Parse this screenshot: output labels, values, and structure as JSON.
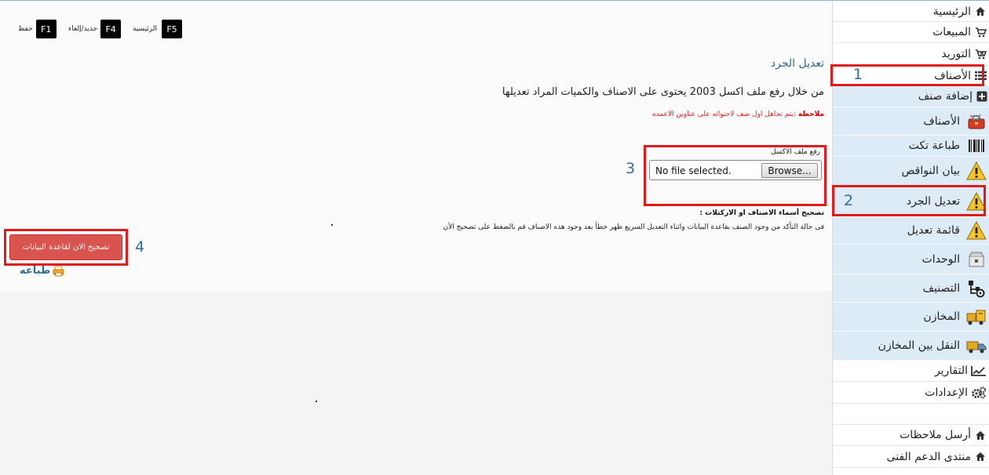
{
  "shortcuts": [
    {
      "key": "F1",
      "label": "حفظ"
    },
    {
      "key": "F4",
      "label": "جديد/إلغاء"
    },
    {
      "key": "F5",
      "label": "الرئيسية"
    }
  ],
  "main": {
    "title": "تعديل الجرد",
    "intro": "من خلال رفع ملف اكسل 2003 يحتوى على الاصناف والكميات المراد تعديلها",
    "note_label": "ملاحظة",
    "note_text": " :يتم تجاهل اول صف لاحتوائه على عناوين الاعمده",
    "upload_label": "رفع ملف الاكسل",
    "file_status": "No file selected.",
    "browse_label": "Browse...",
    "fix_heading": "تصحيح أسماء الاصناف او الاركتلات :",
    "fix_description": "فى حالة التأكد من وجود الصنف بقاعدة البيانات واثناء التعديل السريع ظهر خطأ بعد وجود هذه الاصناف قم بالضغط على تصحيح الأن",
    "fix_button": "تصحيح الان لقاعدة البيانات",
    "print_label": "طباعه"
  },
  "annotations": {
    "n1": "1",
    "n2": "2",
    "n3": "3",
    "n4": "4"
  },
  "sidebar": {
    "items": [
      {
        "label": "الرئيسية",
        "icon": "home-icon"
      },
      {
        "label": "المبيعات",
        "icon": "cart-icon"
      },
      {
        "label": "التوريد",
        "icon": "supply-icon"
      },
      {
        "label": "الأصناف",
        "icon": "list-icon"
      },
      {
        "label": "إضافة صنف",
        "icon": "plus-icon"
      },
      {
        "label": "الأصناف",
        "icon": "toolbox-icon"
      },
      {
        "label": "طباعة تكت",
        "icon": "barcode-icon"
      },
      {
        "label": "بيان النواقص",
        "icon": "warning-icon"
      },
      {
        "label": "تعديل الجرد",
        "icon": "warning-icon"
      },
      {
        "label": "قائمة تعديل",
        "icon": "warning-icon"
      },
      {
        "label": "الوحدات",
        "icon": "box-icon"
      },
      {
        "label": "التصنيف",
        "icon": "tree-icon"
      },
      {
        "label": "المخازن",
        "icon": "warehouse-icon"
      },
      {
        "label": "النقل بين المخازن",
        "icon": "truck-icon"
      },
      {
        "label": "التقارير",
        "icon": "chart-icon"
      },
      {
        "label": "الإعدادات",
        "icon": "gears-icon"
      },
      {
        "label": "أرسل ملاحظات",
        "icon": "home-icon"
      },
      {
        "label": "منتدى الدعم الفنى",
        "icon": "home-icon"
      }
    ]
  },
  "colors": {
    "accent": "#2a6a96",
    "danger": "#d9534f",
    "highlight": "#e01b1b",
    "submenu": "#dcebf5"
  }
}
